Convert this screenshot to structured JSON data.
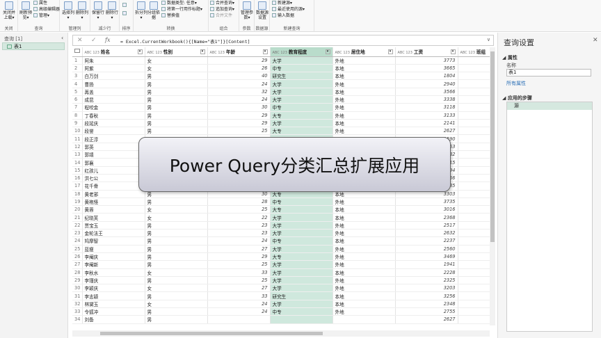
{
  "ribbon": {
    "groups": [
      {
        "label": "关闭",
        "buttons": [
          "关闭并上载▾"
        ]
      },
      {
        "label": "查询",
        "buttons": [
          "刷新预览▾"
        ],
        "small": [
          "属性",
          "高级编辑器",
          "管理▾"
        ]
      },
      {
        "label": "管理列",
        "buttons": [
          "选择列▾",
          "删除列▾"
        ]
      },
      {
        "label": "减少行",
        "buttons": [
          "保留行▾",
          "删除行▾"
        ]
      },
      {
        "label": "排序",
        "buttons": [],
        "small": []
      },
      {
        "label": "转换",
        "buttons": [
          "拆分列▾",
          "分组依据"
        ],
        "small": [
          "数据类型: 任意▾",
          "将第一行用作标题▾",
          "替换值"
        ]
      },
      {
        "label": "组合",
        "buttons": [],
        "small": [
          "合并查询▾",
          "追加查询▾",
          "合并文件"
        ]
      },
      {
        "label": "参数",
        "buttons": [
          "管理参数▾"
        ]
      },
      {
        "label": "数据源",
        "buttons": [
          "数据源设置"
        ]
      },
      {
        "label": "新建查询",
        "buttons": [],
        "small": [
          "新建源▾",
          "最近使用的源▾",
          "输入数据"
        ]
      }
    ]
  },
  "left_pane": {
    "title": "查询 [1]",
    "query_name": "表1"
  },
  "formula": {
    "text": "= Excel.CurrentWorkbook(){[Name=\"表1\"]}[Content]",
    "fx": "fx"
  },
  "table": {
    "columns": [
      {
        "type": "ABC 123",
        "name": "姓名"
      },
      {
        "type": "ABC 123",
        "name": "性别"
      },
      {
        "type": "ABC 123",
        "name": "年龄"
      },
      {
        "type": "ABC 123",
        "name": "教育程度"
      },
      {
        "type": "ABC 123",
        "name": "居住地"
      },
      {
        "type": "ABC 123",
        "name": "工资"
      },
      {
        "type": "ABC 123",
        "name": "班组"
      }
    ],
    "rows": [
      [
        "1",
        "阿朱",
        "女",
        "29",
        "大学",
        "外地",
        "3773"
      ],
      [
        "2",
        "阿紫",
        "女",
        "26",
        "中专",
        "本地",
        "3665"
      ],
      [
        "3",
        "白万剑",
        "男",
        "40",
        "研究生",
        "本地",
        "1804"
      ],
      [
        "4",
        "曹扬",
        "男",
        "24",
        "大学",
        "外地",
        "2940"
      ],
      [
        "5",
        "苒盖",
        "男",
        "32",
        "大学",
        "本地",
        "3566"
      ],
      [
        "6",
        "成昆",
        "男",
        "24",
        "大学",
        "外地",
        "3338"
      ],
      [
        "7",
        "程咬金",
        "男",
        "30",
        "中专",
        "外地",
        "3118"
      ],
      [
        "8",
        "丁春秋",
        "男",
        "29",
        "大专",
        "外地",
        "3133"
      ],
      [
        "9",
        "段延庆",
        "男",
        "29",
        "大学",
        "本地",
        "2141"
      ],
      [
        "10",
        "段誉",
        "男",
        "25",
        "大专",
        "外地",
        "2627"
      ],
      [
        "11",
        "段正淳",
        "男",
        "",
        "",
        "",
        "3590"
      ],
      [
        "12",
        "郭英",
        "男",
        "",
        "",
        "",
        "2653"
      ],
      [
        "13",
        "郭靖",
        "男",
        "",
        "",
        "",
        "2482"
      ],
      [
        "14",
        "郭襄",
        "女",
        "",
        "",
        "",
        "2715"
      ],
      [
        "15",
        "红孩儿",
        "男",
        "",
        "",
        "",
        "2494"
      ],
      [
        "16",
        "洪七公",
        "男",
        "",
        "",
        "",
        "2756"
      ],
      [
        "17",
        "花千骨",
        "女",
        "27",
        "大学",
        "外地",
        "3335"
      ],
      [
        "18",
        "黄老邪",
        "男",
        "30",
        "大专",
        "本地",
        "3303"
      ],
      [
        "19",
        "黄袍怪",
        "男",
        "28",
        "中专",
        "外地",
        "3735"
      ],
      [
        "20",
        "黄蓉",
        "女",
        "25",
        "大专",
        "本地",
        "3016"
      ],
      [
        "21",
        "纪晓芙",
        "女",
        "22",
        "大学",
        "本地",
        "2368"
      ],
      [
        "22",
        "贾宝玉",
        "男",
        "23",
        "大学",
        "外地",
        "2517"
      ],
      [
        "23",
        "金轮法王",
        "男",
        "23",
        "大学",
        "外地",
        "2632"
      ],
      [
        "24",
        "鸠摩智",
        "男",
        "24",
        "中专",
        "本地",
        "2237"
      ],
      [
        "25",
        "蓝瘦",
        "男",
        "27",
        "大学",
        "外地",
        "2560"
      ],
      [
        "26",
        "李阉庆",
        "男",
        "29",
        "大专",
        "外地",
        "3469"
      ],
      [
        "27",
        "李阉新",
        "男",
        "25",
        "大学",
        "外地",
        "1941"
      ],
      [
        "28",
        "李秋水",
        "女",
        "33",
        "大学",
        "本地",
        "2228"
      ],
      [
        "29",
        "李瑾庆",
        "男",
        "25",
        "大学",
        "外地",
        "2325"
      ],
      [
        "30",
        "李颖庆",
        "女",
        "27",
        "大学",
        "外地",
        "3203"
      ],
      [
        "31",
        "李志颖",
        "男",
        "33",
        "研究生",
        "本地",
        "3256"
      ],
      [
        "32",
        "林黛玉",
        "女",
        "24",
        "大学",
        "本地",
        "2348"
      ],
      [
        "33",
        "令狐冲",
        "男",
        "24",
        "中专",
        "外地",
        "2755"
      ],
      [
        "34",
        "刘备",
        "男",
        "",
        "",
        "",
        "2627"
      ]
    ]
  },
  "settings": {
    "title": "查询设置",
    "properties_header": "属性",
    "name_label": "名称",
    "name_value": "表1",
    "all_properties": "所有属性",
    "steps_header": "应用的步骤",
    "step1": "源"
  },
  "banner": {
    "text": "Power Query分类汇总扩展应用"
  }
}
